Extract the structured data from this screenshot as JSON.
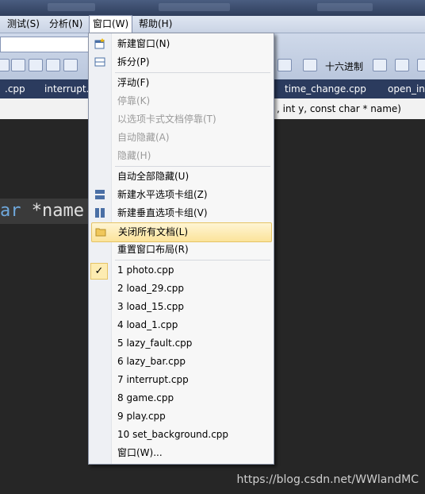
{
  "menubar": {
    "items": [
      {
        "label": "测试(S)"
      },
      {
        "label": "分析(N)"
      },
      {
        "label": "窗口(W)"
      },
      {
        "label": "帮助(H)"
      }
    ]
  },
  "toolbar": {
    "hex_label": "十六进制"
  },
  "tabs": [
    {
      "label": ".cpp"
    },
    {
      "label": "interrupt."
    },
    {
      "label": "time_change.cpp"
    },
    {
      "label": "open_inf"
    }
  ],
  "navbar": {
    "signature": ", int y, const char * name)"
  },
  "editor": {
    "keyword": "ar",
    "identifier": " *name"
  },
  "window_menu": {
    "items": [
      {
        "label": "新建窗口(N)",
        "icon": "new-window-icon"
      },
      {
        "label": "拆分(P)",
        "icon": "split-icon"
      },
      {
        "label": "浮动(F)"
      },
      {
        "label": "停靠(K)",
        "disabled": true
      },
      {
        "label": "以选项卡式文档停靠(T)",
        "disabled": true
      },
      {
        "label": "自动隐藏(A)",
        "disabled": true
      },
      {
        "label": "隐藏(H)",
        "disabled": true
      },
      {
        "label": "自动全部隐藏(U)"
      },
      {
        "label": "新建水平选项卡组(Z)",
        "icon": "horizontal-tab-group-icon"
      },
      {
        "label": "新建垂直选项卡组(V)",
        "icon": "vertical-tab-group-icon"
      },
      {
        "label": "关闭所有文档(L)",
        "icon": "folder-icon",
        "highlighted": true
      },
      {
        "label": "重置窗口布局(R)"
      },
      {
        "label": "1 photo.cpp",
        "checked": true
      },
      {
        "label": "2 load_29.cpp"
      },
      {
        "label": "3 load_15.cpp"
      },
      {
        "label": "4 load_1.cpp"
      },
      {
        "label": "5 lazy_fault.cpp"
      },
      {
        "label": "6 lazy_bar.cpp"
      },
      {
        "label": "7 interrupt.cpp"
      },
      {
        "label": "8 game.cpp"
      },
      {
        "label": "9 play.cpp"
      },
      {
        "label": "10 set_background.cpp"
      },
      {
        "label": "窗口(W)..."
      }
    ]
  },
  "watermark": "https://blog.csdn.net/WWlandMC"
}
